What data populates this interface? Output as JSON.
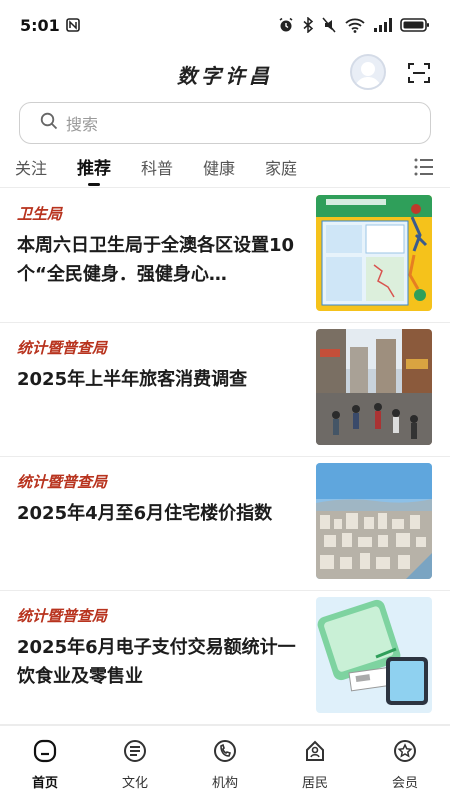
{
  "status_bar": {
    "time": "5:01",
    "icons": [
      "nfc-icon",
      "alarm-icon",
      "bluetooth-icon",
      "mute-icon",
      "wifi-icon",
      "signal-icon",
      "battery-icon"
    ]
  },
  "header": {
    "title": "数字许昌"
  },
  "search": {
    "placeholder": "搜索"
  },
  "tabs": [
    {
      "label": "关注",
      "active": false
    },
    {
      "label": "推荐",
      "active": true
    },
    {
      "label": "科普",
      "active": false
    },
    {
      "label": "健康",
      "active": false
    },
    {
      "label": "家庭",
      "active": false
    }
  ],
  "feed": [
    {
      "source": "卫生局",
      "title": "本周六日卫生局于全澳各区设置10个“全民健身．强健身心…"
    },
    {
      "source": "统计暨普查局",
      "title": "2025年上半年旅客消费调查"
    },
    {
      "source": "统计暨普查局",
      "title": "2025年4月至6月住宅楼价指数"
    },
    {
      "source": "统计暨普查局",
      "title": "2025年6月电子支付交易额统计一饮食业及零售业"
    }
  ],
  "bottom_nav": [
    {
      "label": "首页",
      "icon": "home-icon",
      "active": true
    },
    {
      "label": "文化",
      "icon": "culture-icon",
      "active": false
    },
    {
      "label": "机构",
      "icon": "institution-icon",
      "active": false
    },
    {
      "label": "居民",
      "icon": "resident-icon",
      "active": false
    },
    {
      "label": "会员",
      "icon": "member-icon",
      "active": false
    }
  ],
  "colors": {
    "source_red": "#b8331e",
    "text_dark": "#1c1c1c",
    "divider": "#ececec"
  }
}
